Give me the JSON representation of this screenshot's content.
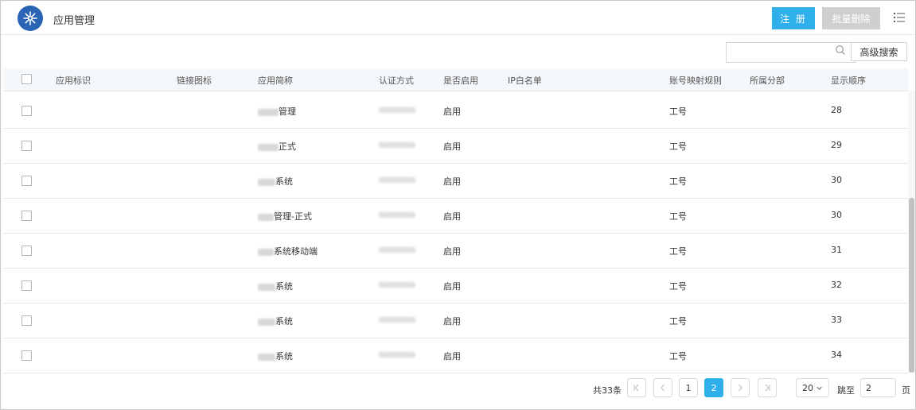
{
  "header": {
    "title": "应用管理",
    "register_label": "注 册",
    "batch_delete_label": "批量删除"
  },
  "search": {
    "placeholder": "",
    "advanced_label": "高级搜索"
  },
  "table": {
    "columns": [
      "应用标识",
      "链接图标",
      "应用简称",
      "认证方式",
      "是否启用",
      "IP白名单",
      "账号映射规则",
      "所属分部",
      "显示顺序"
    ],
    "rows": [
      {
        "name": "管理",
        "enabled": "启用",
        "mapping": "工号",
        "order": "28"
      },
      {
        "name": "正式",
        "enabled": "启用",
        "mapping": "工号",
        "order": "29"
      },
      {
        "name": "系统",
        "enabled": "启用",
        "mapping": "工号",
        "order": "30"
      },
      {
        "name": "管理-正式",
        "enabled": "启用",
        "mapping": "工号",
        "order": "30"
      },
      {
        "name": "系统移动端",
        "enabled": "启用",
        "mapping": "工号",
        "order": "31"
      },
      {
        "name": "系统",
        "enabled": "启用",
        "mapping": "工号",
        "order": "32"
      },
      {
        "name": "系统",
        "enabled": "启用",
        "mapping": "工号",
        "order": "33"
      },
      {
        "name": "系统",
        "enabled": "启用",
        "mapping": "工号",
        "order": "34"
      }
    ]
  },
  "pagination": {
    "total_label": "共33条",
    "pages": [
      "1",
      "2"
    ],
    "current_page": "2",
    "page_size": "20",
    "jump_label": "跳至",
    "jump_value": "2",
    "page_unit": "页"
  },
  "colors": {
    "accent": "#2fb0ea",
    "logo": "#2a64b4",
    "disabled_button": "#cfcfcf"
  }
}
